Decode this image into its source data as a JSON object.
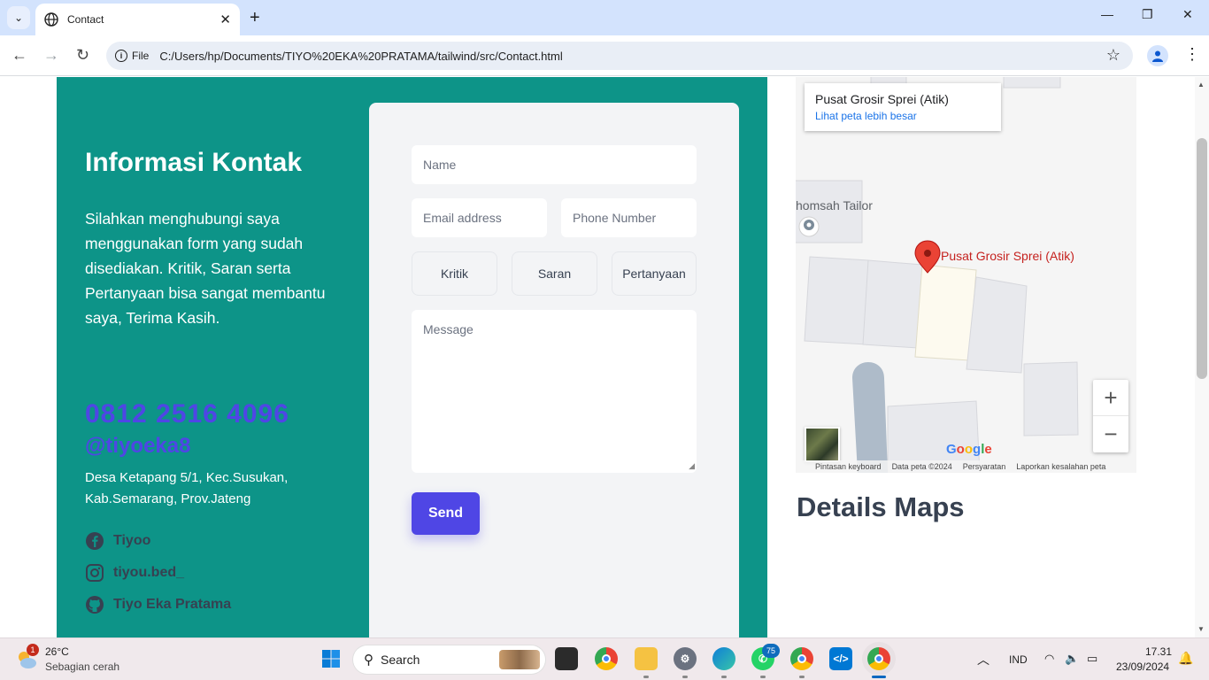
{
  "browser": {
    "tab_title": "Contact",
    "new_tab": "+",
    "chip_label": "File",
    "url": "C:/Users/hp/Documents/TIYO%20EKA%20PRATAMA/tailwind/src/Contact.html"
  },
  "contact": {
    "title": "Informasi Kontak",
    "description": "Silahkan menghubungi saya menggunakan form yang sudah disediakan. Kritik, Saran serta Pertanyaan bisa sangat membantu saya, Terima Kasih.",
    "phone": "0812 2516 4096",
    "handle": "@tiyoeka8",
    "address": "Desa Ketapang 5/1, Kec.Susukan, Kab.Semarang, Prov.Jateng",
    "socials": [
      {
        "icon": "facebook-icon",
        "label": "Tiyoo"
      },
      {
        "icon": "instagram-icon",
        "label": "tiyou.bed_"
      },
      {
        "icon": "github-icon",
        "label": "Tiyo Eka Pratama"
      }
    ]
  },
  "form": {
    "name_placeholder": "Name",
    "email_placeholder": "Email address",
    "phone_placeholder": "Phone Number",
    "choices": [
      "Kritik",
      "Saran",
      "Pertanyaan"
    ],
    "message_placeholder": "Message",
    "send_label": "Send"
  },
  "map": {
    "place_name": "Pusat Grosir Sprei (Atik)",
    "larger_map_link": "Lihat peta lebih besar",
    "nearby_label": "homsah Tailor",
    "pin_label": "Pusat Grosir Sprei (Atik)",
    "google": "Google",
    "attribution": [
      "Pintasan keyboard",
      "Data peta ©2024",
      "Persyaratan",
      "Laporkan kesalahan peta"
    ],
    "zoom_in": "+",
    "zoom_out": "−"
  },
  "details_heading": "Details Maps",
  "taskbar": {
    "weather_badge": "1",
    "temperature": "26°C",
    "condition": "Sebagian cerah",
    "search_label": "Search",
    "whatsapp_badge": "75",
    "language": "IND",
    "time": "17.31",
    "date": "23/09/2024"
  },
  "colors": {
    "teal": "#0d9488",
    "indigo": "#4f46e5",
    "link_blue": "#1a73e8",
    "pin_red": "#ea4335"
  }
}
